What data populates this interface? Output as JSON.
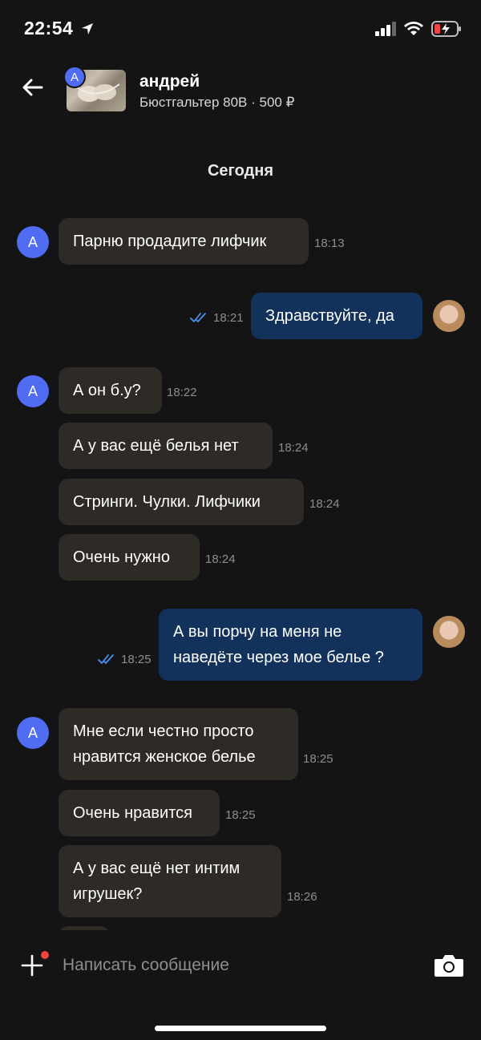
{
  "status": {
    "time": "22:54"
  },
  "header": {
    "avatar_letter": "А",
    "name": "андрей",
    "subtitle": "Бюстгальтер 80В · 500 ₽"
  },
  "day_label": "Сегодня",
  "messages": [
    {
      "dir": "in",
      "text": "Парню продадите лифчик",
      "time": "18:13"
    },
    {
      "dir": "out",
      "text": "Здравствуйте, да",
      "time": "18:21"
    },
    {
      "dir": "in",
      "text": "А он б.у?",
      "time": "18:22"
    },
    {
      "dir": "in",
      "text": "А у вас ещё белья нет",
      "time": "18:24"
    },
    {
      "dir": "in",
      "text": "Стринги. Чулки. Лифчики",
      "time": "18:24"
    },
    {
      "dir": "in",
      "text": "Очень нужно",
      "time": "18:24"
    },
    {
      "dir": "out",
      "text_line1": "А вы порчу на меня не",
      "text_line2": "наведёте через мое белье ?",
      "time": "18:25"
    },
    {
      "dir": "in",
      "text_line1": "Мне если честно просто",
      "text_line2": "нравится женское белье",
      "time": "18:25"
    },
    {
      "dir": "in",
      "text": "Очень нравится",
      "time": "18:25"
    },
    {
      "dir": "in",
      "text_line1": "А у вас ещё нет интим",
      "text_line2": "игрушек?",
      "time": "18:26"
    }
  ],
  "composer": {
    "placeholder": "Написать сообщение"
  },
  "icons": {
    "back": "arrow-left-icon",
    "plus": "plus-icon",
    "camera": "camera-icon",
    "read": "double-check-icon"
  },
  "colors": {
    "incoming": "#2e2b27",
    "outgoing": "#12315b",
    "avatar": "#4f6cf2",
    "check": "#4a90f0"
  }
}
